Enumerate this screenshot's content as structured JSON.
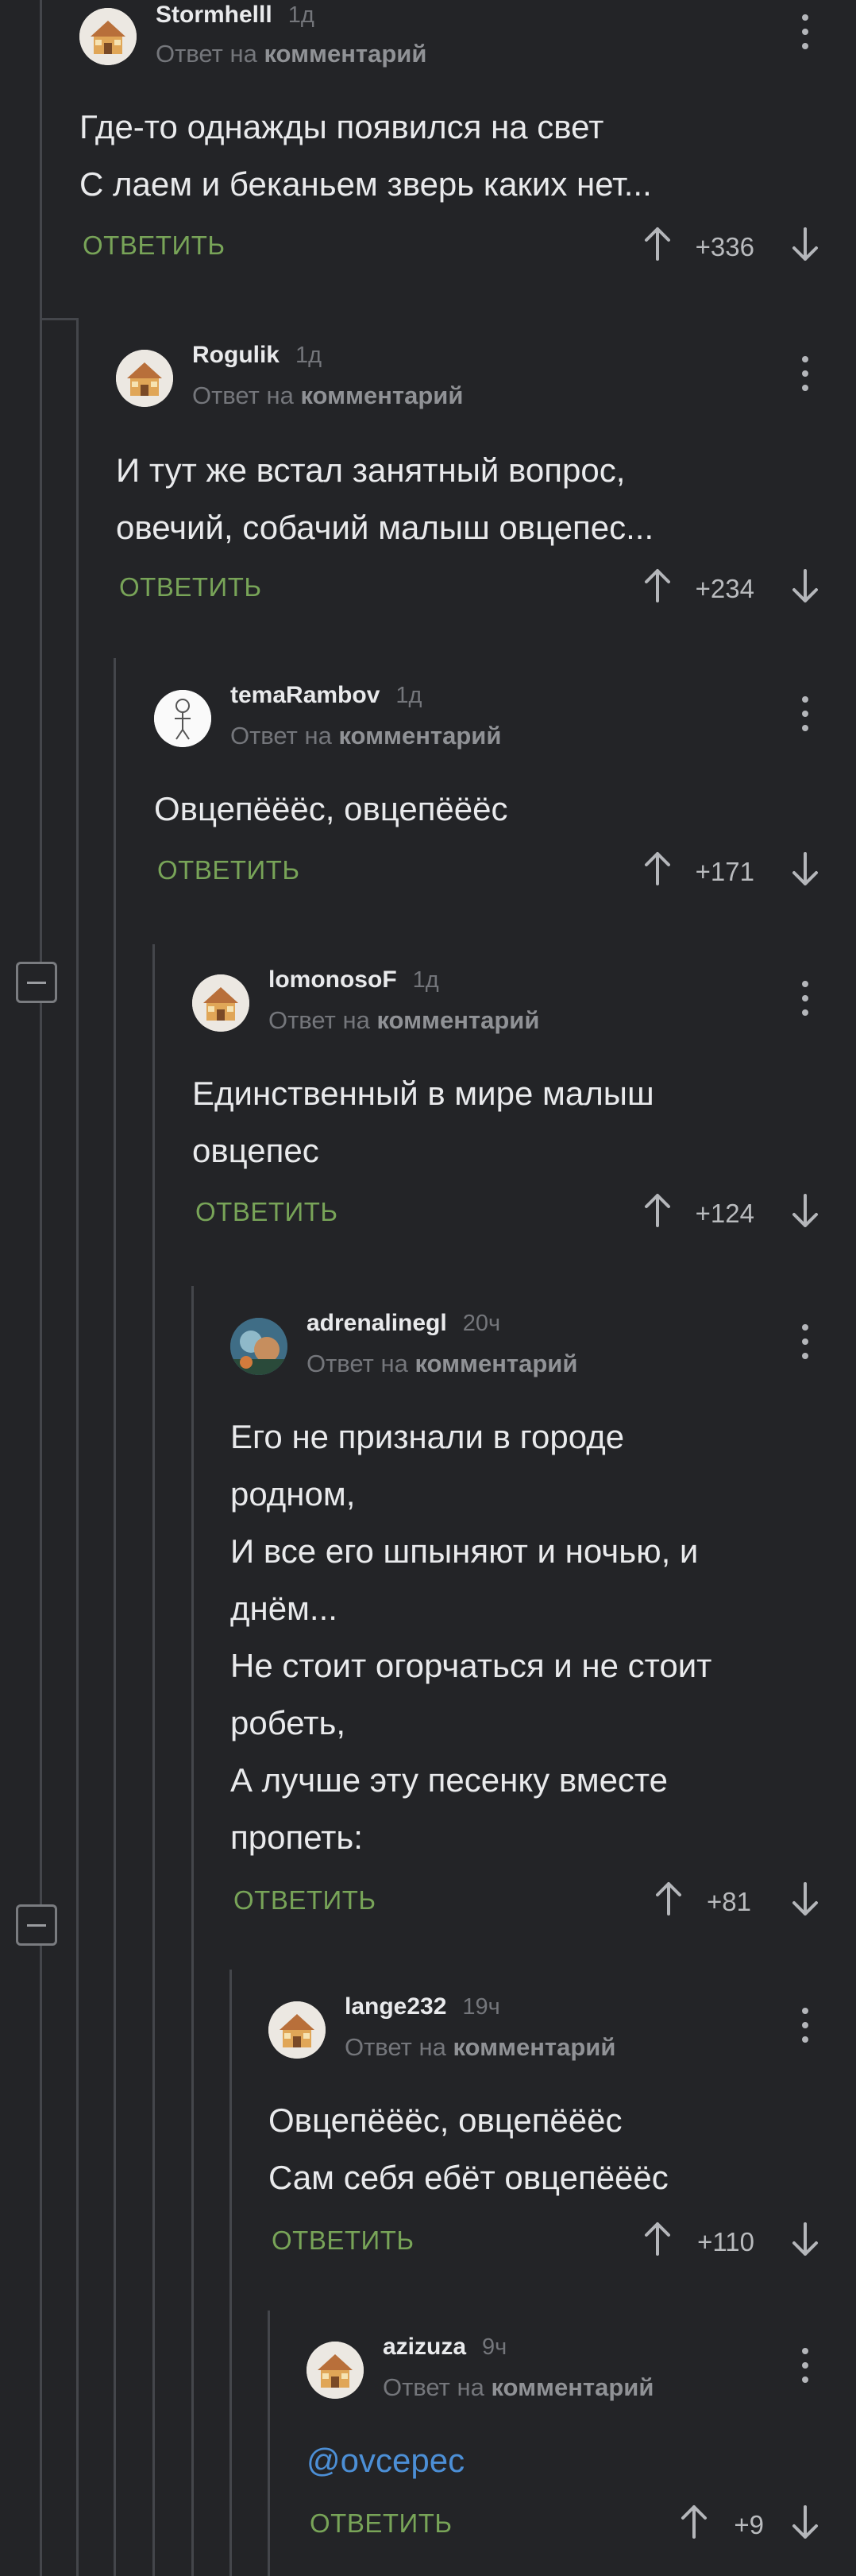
{
  "reply_label": "ОТВЕТИТЬ",
  "reply_prefix": "Ответ на",
  "reply_target": "комментарий",
  "comments": [
    {
      "username": "Stormhelll",
      "time": "1д",
      "lines": "Где-то однажды появился на свет\nС лаем и беканьем зверь каких нет...",
      "rating": "+336",
      "avatar_icon": "house-avatar-icon"
    },
    {
      "username": "Rogulik",
      "time": "1д",
      "lines": "И тут же встал занятный вопрос,\nовечий, собачий малыш овцепес...",
      "rating": "+234",
      "avatar_icon": "house-avatar-icon"
    },
    {
      "username": "temaRambov",
      "time": "1д",
      "lines": "Овцепёёёс, овцепёёёс",
      "rating": "+171",
      "avatar_icon": "sketch-avatar-icon"
    },
    {
      "username": "lomonosoF",
      "time": "1д",
      "lines": "Единственный в мире малыш\nовцепес",
      "rating": "+124",
      "avatar_icon": "house-avatar-icon"
    },
    {
      "username": "adrenalinegl",
      "time": "20ч",
      "lines": "Его не признали в городе\nродном,\nИ все его шпыняют и ночью, и\nднём...\nНе стоит огорчаться и не стоит\nробеть,\nА лучше эту песенку вместе\nпропеть:",
      "rating": "+81",
      "avatar_icon": "photo-avatar-icon"
    },
    {
      "username": "lange232",
      "time": "19ч",
      "lines": "Овцепёёёс, овцепёёёс\nСам себя ебёт овцепёёёс",
      "rating": "+110",
      "avatar_icon": "house-avatar-icon"
    },
    {
      "username": "azizuza",
      "time": "9ч",
      "lines": "@ovcepec",
      "rating": "+9",
      "avatar_icon": "house-avatar-icon"
    }
  ],
  "colors": {
    "background": "#232427",
    "reply_action": "#78a458",
    "mention": "#4c8fd6",
    "muted": "#74767b"
  }
}
